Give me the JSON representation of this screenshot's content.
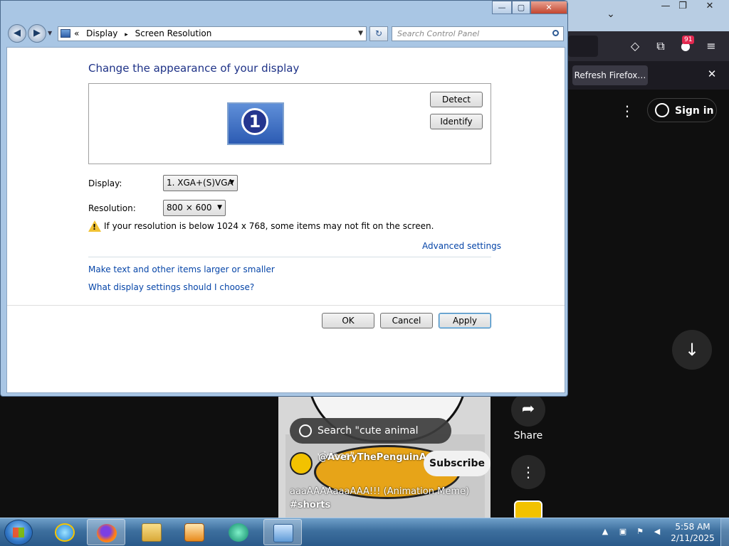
{
  "firefox": {
    "window_controls": [
      "—",
      "❐",
      "✕"
    ],
    "chevron": "⌄",
    "badge_count": "91",
    "notification_button": "Refresh Firefox…",
    "notification_close": "✕",
    "icons": [
      "pocket-icon",
      "extensions-icon",
      "notification-icon",
      "hamburger-menu-icon"
    ]
  },
  "youtube": {
    "more_dots": "⋮",
    "sign_in_label": "Sign in",
    "scroll_down_glyph": "↓",
    "short_search": "Search \"cute animal videos\"",
    "channel_name": "@AveryThePenguinAnimations",
    "subscribe_label": "Subscribe",
    "short_title": "aaaAAAAaaaAAA!!!  (Animation Meme)",
    "short_hashtag": "#shorts",
    "share_glyph": "➦",
    "share_label": "Share",
    "more_glyph": "⋮"
  },
  "control_panel": {
    "window_buttons": [
      "—",
      "▢",
      "✕"
    ],
    "back_glyph": "◀",
    "forward_glyph": "▶",
    "breadcrumb_prefix": "«",
    "breadcrumb": [
      "Display",
      "Screen Resolution"
    ],
    "breadcrumb_separator": "▸",
    "address_dropdown": "▼",
    "refresh_glyph": "↻",
    "search_placeholder": "Search Control Panel",
    "heading": "Change the appearance of your display",
    "monitor_number": "1",
    "detect_label": "Detect",
    "identify_label": "Identify",
    "display_label": "Display:",
    "display_value": "1. XGA+(S)VGA",
    "resolution_label": "Resolution:",
    "resolution_value": "800 × 600",
    "select_arrow": "▼",
    "warning_text": "If your resolution is below 1024 x 768, some items may not fit on the screen.",
    "advanced_settings": "Advanced settings",
    "link_text_size": "Make text and other items larger or smaller",
    "link_what_settings": "What display settings should I choose?",
    "ok_label": "OK",
    "cancel_label": "Cancel",
    "apply_label": "Apply"
  },
  "taskbar": {
    "items": [
      "internet-explorer-icon",
      "firefox-icon",
      "file-explorer-icon",
      "media-player-icon",
      "media-center-icon",
      "control-panel-icon"
    ],
    "tray_arrow": "▲",
    "clock_time": "5:58 AM",
    "clock_date": "2/11/2025"
  },
  "colors": {
    "heading_blue": "#1e3287",
    "link_blue": "#0645a8",
    "youtube_bg": "#0f0f0f",
    "firefox_toolbar": "#2b2a33",
    "taskbar_blue": "#3d6f9e"
  }
}
